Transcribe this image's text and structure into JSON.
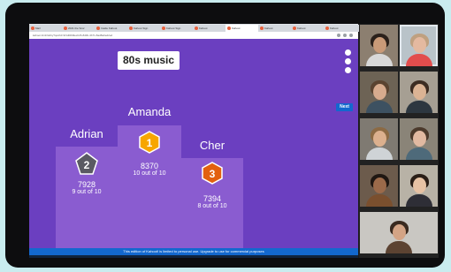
{
  "browser": {
    "tabs": [
      {
        "label": "Mail"
      },
      {
        "label": "2021 the Scor"
      },
      {
        "label": "Inside Kahoot"
      },
      {
        "label": "Kahoot Sign"
      },
      {
        "label": "Kahoot Sign"
      },
      {
        "label": "Kahoot"
      },
      {
        "label": "Kahoot",
        "active": true
      },
      {
        "label": "Kahoot"
      },
      {
        "label": "Kahoot"
      },
      {
        "label": "Kahoot"
      }
    ],
    "url": "kahoot.it/v2/lobby?quizId=9/1db8d9e2c26-8d0b-4b71-8ad8a0ed2ed"
  },
  "game": {
    "title": "80s music",
    "next_label": "Next",
    "podium": [
      {
        "place": "2",
        "name": "Adrian",
        "score": "7928",
        "detail": "9 out of 10",
        "color": "#5a5a63"
      },
      {
        "place": "1",
        "name": "Amanda",
        "score": "8370",
        "detail": "10 out of 10",
        "color": "#f7a600"
      },
      {
        "place": "3",
        "name": "Cher",
        "score": "7394",
        "detail": "8 out of 10",
        "color": "#e2600f"
      }
    ],
    "footer_text": "This edition of Kahoot! is limited to personal use. Upgrade to use for commercial purposes"
  },
  "colors": {
    "stage": "#6b3fc0",
    "podium": "#8a5cd0",
    "footer": "#1368ce"
  },
  "participants": [
    {
      "skin": "#c99a78",
      "hair": "#2b211b",
      "shirt": "#d8d8d8",
      "bg": "#8c7f70"
    },
    {
      "skin": "#e4b9a0",
      "hair": "#bfa080",
      "shirt": "#e24d4d",
      "bg": "#b9c3c9",
      "selected": true
    },
    {
      "skin": "#d7ab8e",
      "hair": "#5a4330",
      "shirt": "#3d5161",
      "bg": "#6d6355"
    },
    {
      "skin": "#dbb394",
      "hair": "#3c2c22",
      "shirt": "#2d3740",
      "bg": "#a69f93"
    },
    {
      "skin": "#dcb08e",
      "hair": "#8c6a44",
      "shirt": "#cfd3d6",
      "bg": "#7f7a72"
    },
    {
      "skin": "#e1b9a1",
      "hair": "#4c3a2c",
      "shirt": "#4e6a7a",
      "bg": "#8a8478"
    },
    {
      "skin": "#9b6a4a",
      "hair": "#1f1712",
      "shirt": "#7a4f2e",
      "bg": "#6c5b4c"
    },
    {
      "skin": "#e7c2a4",
      "hair": "#2a1e17",
      "shirt": "#2e2e36",
      "bg": "#b8b2a6"
    },
    {
      "skin": "#d4a485",
      "hair": "#3a2a1f",
      "shirt": "#5c4332",
      "bg": "#c9c7c2"
    }
  ]
}
